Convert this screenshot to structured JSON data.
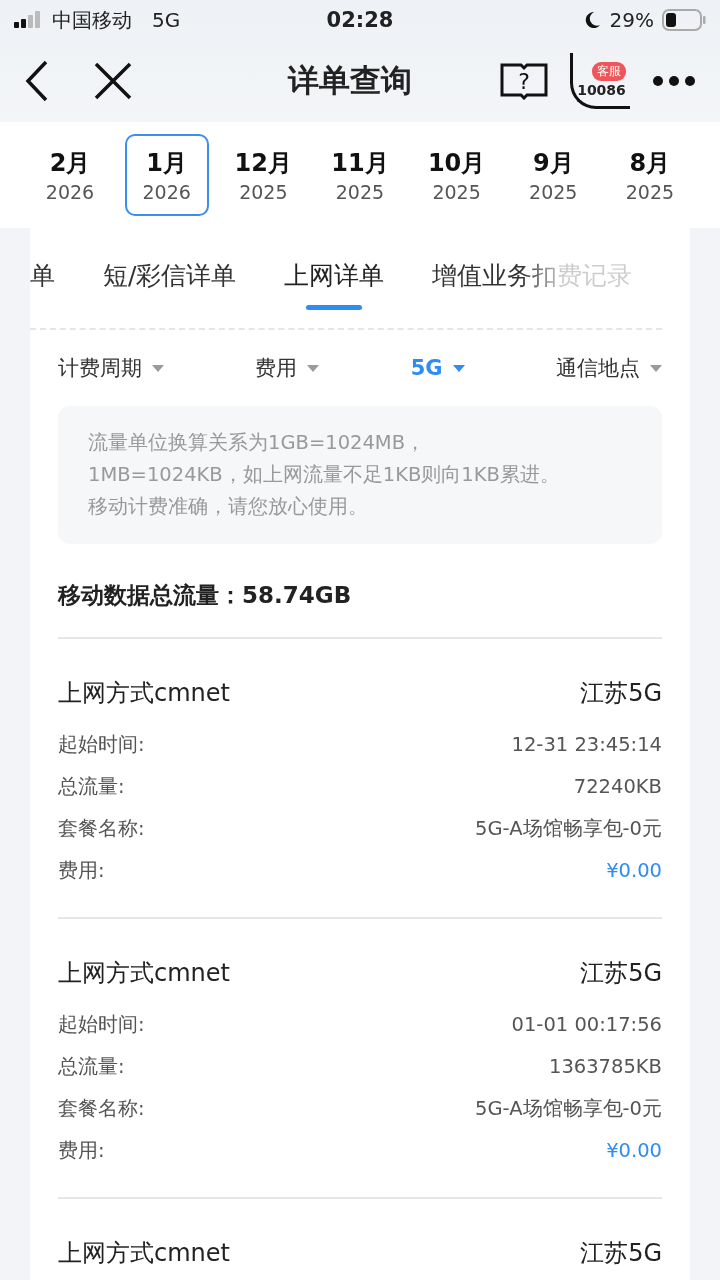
{
  "status_bar": {
    "carrier": "中国移动",
    "network": "5G",
    "time": "02:28",
    "battery": "29%"
  },
  "nav": {
    "title": "详单查询",
    "help": "?",
    "badge": "客服",
    "hotline": "10086"
  },
  "months": [
    {
      "month": "2月",
      "year": "2026",
      "selected": false
    },
    {
      "month": "1月",
      "year": "2026",
      "selected": true
    },
    {
      "month": "12月",
      "year": "2025",
      "selected": false
    },
    {
      "month": "11月",
      "year": "2025",
      "selected": false
    },
    {
      "month": "10月",
      "year": "2025",
      "selected": false
    },
    {
      "month": "9月",
      "year": "2025",
      "selected": false
    },
    {
      "month": "8月",
      "year": "2025",
      "selected": false
    }
  ],
  "tabs": [
    {
      "label": "单",
      "selected": false
    },
    {
      "label": "短/彩信详单",
      "selected": false
    },
    {
      "label": "上网详单",
      "selected": true
    },
    {
      "label": "增值业务扣费记录",
      "selected": false
    }
  ],
  "filters": [
    {
      "label": "计费周期",
      "selected": false
    },
    {
      "label": "费用",
      "selected": false
    },
    {
      "label": "5G",
      "selected": true
    },
    {
      "label": "通信地点",
      "selected": false
    }
  ],
  "notice": [
    "流量单位换算关系为1GB=1024MB，",
    "1MB=1024KB，如上网流量不足1KB则向1KB累进。",
    "移动计费准确，请您放心使用。"
  ],
  "total": "移动数据总流量：58.74GB",
  "records": [
    {
      "title": "上网方式cmnet",
      "location": "江苏5G",
      "fields": [
        {
          "label": "起始时间:",
          "value": "12-31 23:45:14",
          "kind": "plain"
        },
        {
          "label": "总流量:",
          "value": "72240KB",
          "kind": "plain"
        },
        {
          "label": "套餐名称:",
          "value": "5G-A场馆畅享包-0元",
          "kind": "plain"
        },
        {
          "label": "费用:",
          "value": "¥0.00",
          "kind": "fee"
        }
      ]
    },
    {
      "title": "上网方式cmnet",
      "location": "江苏5G",
      "fields": [
        {
          "label": "起始时间:",
          "value": "01-01 00:17:56",
          "kind": "plain"
        },
        {
          "label": "总流量:",
          "value": "1363785KB",
          "kind": "plain"
        },
        {
          "label": "套餐名称:",
          "value": "5G-A场馆畅享包-0元",
          "kind": "plain"
        },
        {
          "label": "费用:",
          "value": "¥0.00",
          "kind": "fee"
        }
      ]
    },
    {
      "title": "上网方式cmnet",
      "location": "江苏5G"
    }
  ]
}
